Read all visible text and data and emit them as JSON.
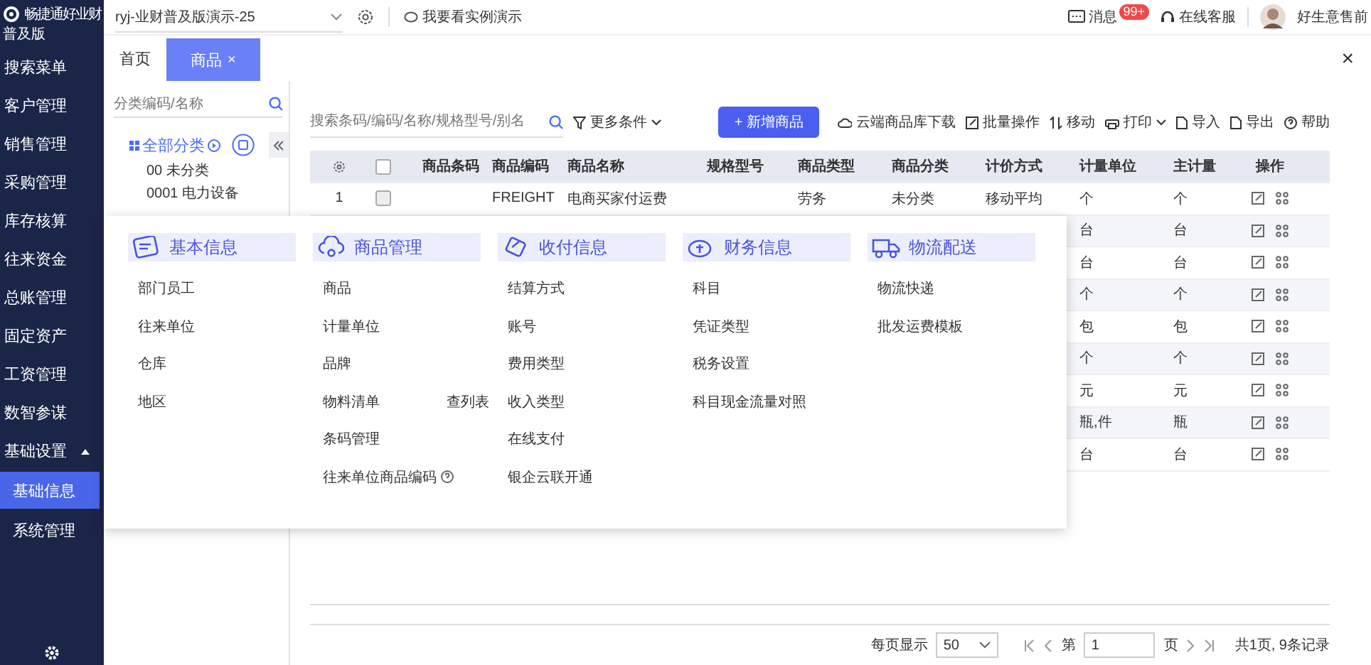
{
  "sidebar": {
    "logo_text": "畅捷通好业财",
    "edition": "普及版",
    "items": [
      {
        "label": "搜索菜单",
        "selected": false
      },
      {
        "label": "客户管理",
        "selected": false
      },
      {
        "label": "销售管理",
        "selected": false
      },
      {
        "label": "采购管理",
        "selected": false
      },
      {
        "label": "库存核算",
        "selected": false
      },
      {
        "label": "往来资金",
        "selected": false
      },
      {
        "label": "总账管理",
        "selected": false
      },
      {
        "label": "固定资产",
        "selected": false
      },
      {
        "label": "工资管理",
        "selected": false
      },
      {
        "label": "数智参谋",
        "selected": false
      },
      {
        "label": "基础设置",
        "selected": false,
        "expanded": true,
        "children": [
          {
            "label": "基础信息",
            "selected": true
          },
          {
            "label": "系统管理",
            "selected": false
          }
        ]
      }
    ]
  },
  "top_bar": {
    "account": "ryj-业财普及版演示-25",
    "demo_link": "我要看实例演示",
    "messages": "消息",
    "badge": "99+",
    "service": "在线客服",
    "user": "好生意售前"
  },
  "tabs": [
    {
      "label": "首页",
      "selected": false
    },
    {
      "label": "商品",
      "selected": true,
      "close": "×"
    }
  ],
  "close_button": "×",
  "category_panel": {
    "search_placeholder": "分类编码/名称",
    "root": "全部分类",
    "items": [
      "00 未分类",
      "0001 电力设备"
    ]
  },
  "toolbar": {
    "search_placeholder": "搜索条码/编码/名称/规格型号/别名",
    "more_filters": "更多条件",
    "primary": "+ 新增商品",
    "actions": [
      {
        "label": "云端商品库下载",
        "dropdown": false
      },
      {
        "label": "批量操作",
        "dropdown": false
      },
      {
        "label": "移动",
        "dropdown": false
      },
      {
        "label": "打印",
        "dropdown": true
      },
      {
        "label": "导入",
        "dropdown": false
      },
      {
        "label": "导出",
        "dropdown": false
      },
      {
        "label": "帮助",
        "dropdown": false
      }
    ]
  },
  "table": {
    "header_checked": false,
    "columns": [
      "商品条码",
      "商品编码",
      "商品名称",
      "规格型号",
      "商品类型",
      "商品分类",
      "计价方式",
      "计量单位",
      "主计量",
      "操作"
    ],
    "rows": [
      {
        "row_number": "1",
        "checked": false,
        "code": "FREIGHT",
        "name": "电商买家付运费",
        "type": "劳务",
        "category": "未分类",
        "pricing": "移动平均",
        "unit": "个",
        "main_unit": "个"
      },
      {
        "unit": "台",
        "main_unit": "台"
      },
      {
        "unit": "台",
        "main_unit": "台"
      },
      {
        "unit": "个",
        "main_unit": "个"
      },
      {
        "unit": "包",
        "main_unit": "包"
      },
      {
        "unit": "个",
        "main_unit": "个"
      },
      {
        "unit": "元",
        "main_unit": "元"
      },
      {
        "unit": "瓶,件",
        "main_unit": "瓶"
      },
      {
        "unit": "台",
        "main_unit": "台"
      }
    ]
  },
  "menu": {
    "columns": [
      {
        "title": "基本信息",
        "items": [
          {
            "label": "部门员工"
          },
          {
            "label": "往来单位"
          },
          {
            "label": "仓库"
          },
          {
            "label": "地区"
          }
        ]
      },
      {
        "title": "商品管理",
        "items": [
          {
            "label": "商品"
          },
          {
            "label": "计量单位"
          },
          {
            "label": "品牌"
          },
          {
            "label": "物料清单",
            "extra": "查列表"
          },
          {
            "label": "条码管理"
          },
          {
            "label": "往来单位商品编码",
            "help": true
          }
        ]
      },
      {
        "title": "收付信息",
        "items": [
          {
            "label": "结算方式"
          },
          {
            "label": "账号"
          },
          {
            "label": "费用类型"
          },
          {
            "label": "收入类型"
          },
          {
            "label": "在线支付"
          },
          {
            "label": "银企云联开通"
          }
        ]
      },
      {
        "title": "财务信息",
        "items": [
          {
            "label": "科目"
          },
          {
            "label": "凭证类型"
          },
          {
            "label": "税务设置"
          },
          {
            "label": "科目现金流量对照"
          }
        ]
      },
      {
        "title": "物流配送",
        "items": [
          {
            "label": "物流快递"
          },
          {
            "label": "批发运费模板"
          }
        ]
      }
    ]
  },
  "pagination": {
    "per_page_label": "每页显示",
    "per_page": "50",
    "page_prefix": "第",
    "page": "1",
    "page_suffix": "页",
    "summary": "共1页, 9条记录"
  }
}
